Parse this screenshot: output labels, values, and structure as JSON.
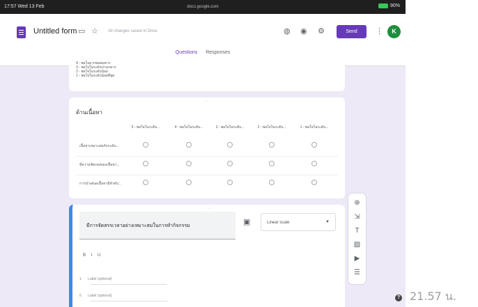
{
  "status_bar": {
    "left": "17:57 Wed 13 Feb",
    "url": "docs.google.com",
    "battery": "90%"
  },
  "app": {
    "doc_title": "Untitled form",
    "saved_status": "All changes saved in Drive",
    "send_label": "Send",
    "avatar_letter": "K"
  },
  "tabs": [
    {
      "label": "Questions",
      "active": true
    },
    {
      "label": "Responses",
      "active": false
    }
  ],
  "top_card": {
    "lines": [
      "4 - พอใจมากพอสมควร",
      "3 - พอใจในระดับปานกลาง",
      "2 - พอใจในระดับน้อย",
      "1 - พอใจในระดับน้อยที่สุด"
    ]
  },
  "grid_card": {
    "title": "ด้านเนื้อหา",
    "columns": [
      "5 - พอใจในระดับ...",
      "4 - พอใจในระดับ...",
      "3 - พอใจในระดับ...",
      "2 - พอใจในระดับ...",
      "1 - พอใจในระดับ..."
    ],
    "rows": [
      "เนื้อหาเหมาะสมกับระดับ...",
      "มีความชัดเจนของเนื้อหา...",
      "การนำเสนอเนื้อหามีลำดับ..."
    ]
  },
  "question_card": {
    "question_text": "มีการจัดสรรเวลาอย่างเหมาะสมในการทำกิจกรรม",
    "type_label": "Linear scale",
    "format_icons": "B I U",
    "options": [
      {
        "num": "1",
        "placeholder": "Label (optional)"
      },
      {
        "num": "5",
        "placeholder": "Label (optional)"
      }
    ]
  },
  "sidebar_icons": [
    "add-question-icon",
    "import-questions-icon",
    "add-title-icon",
    "add-image-icon",
    "add-video-icon",
    "add-section-icon"
  ],
  "timestamp": "21.57 น."
}
